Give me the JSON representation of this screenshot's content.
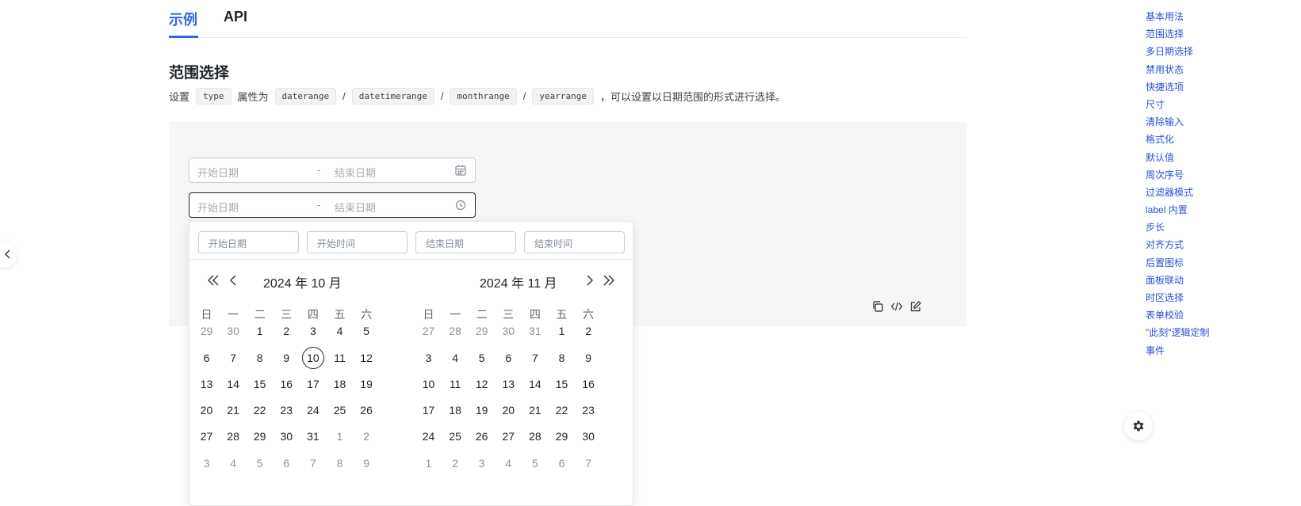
{
  "tabs": [
    {
      "label": "示例"
    },
    {
      "label": "API"
    }
  ],
  "section": {
    "title": "范围选择",
    "desc_prefix": "设置",
    "desc_attr": "type",
    "desc_mid": "属性为",
    "desc_values": [
      "daterange",
      "datetimerange",
      "monthrange",
      "yearrange"
    ],
    "desc_sep": "/",
    "desc_suffix": "，可以设置以日期范围的形式进行选择。"
  },
  "inputs": [
    {
      "start_placeholder": "开始日期",
      "separator": "-",
      "end_placeholder": "结束日期",
      "icon": "calendar-icon"
    },
    {
      "start_placeholder": "开始日期",
      "separator": "-",
      "end_placeholder": "结束日期",
      "icon": "clock-icon"
    }
  ],
  "panel": {
    "start_date_placeholder": "开始日期",
    "start_time_placeholder": "开始时间",
    "end_date_placeholder": "结束日期",
    "end_time_placeholder": "结束时间",
    "left_title": "2024 年 10 月",
    "right_title": "2024 年 11 月",
    "weekdays": [
      "日",
      "一",
      "二",
      "三",
      "四",
      "五",
      "六"
    ],
    "left_days": [
      [
        "29",
        "30",
        "1",
        "2",
        "3",
        "4",
        "5"
      ],
      [
        "6",
        "7",
        "8",
        "9",
        "10",
        "11",
        "12"
      ],
      [
        "13",
        "14",
        "15",
        "16",
        "17",
        "18",
        "19"
      ],
      [
        "20",
        "21",
        "22",
        "23",
        "24",
        "25",
        "26"
      ],
      [
        "27",
        "28",
        "29",
        "30",
        "31",
        "1",
        "2"
      ],
      [
        "3",
        "4",
        "5",
        "6",
        "7",
        "8",
        "9"
      ]
    ],
    "left_muted": [
      [
        0,
        0
      ],
      [
        0,
        1
      ],
      [
        4,
        5
      ],
      [
        4,
        6
      ],
      [
        5,
        0
      ],
      [
        5,
        1
      ],
      [
        5,
        2
      ],
      [
        5,
        3
      ],
      [
        5,
        4
      ],
      [
        5,
        5
      ],
      [
        5,
        6
      ]
    ],
    "left_today": [
      1,
      4
    ],
    "right_days": [
      [
        "27",
        "28",
        "29",
        "30",
        "31",
        "1",
        "2"
      ],
      [
        "3",
        "4",
        "5",
        "6",
        "7",
        "8",
        "9"
      ],
      [
        "10",
        "11",
        "12",
        "13",
        "14",
        "15",
        "16"
      ],
      [
        "17",
        "18",
        "19",
        "20",
        "21",
        "22",
        "23"
      ],
      [
        "24",
        "25",
        "26",
        "27",
        "28",
        "29",
        "30"
      ],
      [
        "1",
        "2",
        "3",
        "4",
        "5",
        "6",
        "7"
      ]
    ],
    "right_muted": [
      [
        0,
        0
      ],
      [
        0,
        1
      ],
      [
        0,
        2
      ],
      [
        0,
        3
      ],
      [
        0,
        4
      ],
      [
        5,
        0
      ],
      [
        5,
        1
      ],
      [
        5,
        2
      ],
      [
        5,
        3
      ],
      [
        5,
        4
      ],
      [
        5,
        5
      ],
      [
        5,
        6
      ]
    ]
  },
  "toc": [
    "基本用法",
    "范围选择",
    "多日期选择",
    "禁用状态",
    "快捷选项",
    "尺寸",
    "清除输入",
    "格式化",
    "默认值",
    "周次序号",
    "过滤器模式",
    "label 内置",
    "步长",
    "对齐方式",
    "后置图标",
    "面板联动",
    "时区选择",
    "表单校验",
    "\"此刻\"逻辑定制",
    "事件"
  ],
  "colors": {
    "accent": "#3366dd",
    "toc_link": "#2b4fd9",
    "demo_bg": "#f6f6f7"
  }
}
